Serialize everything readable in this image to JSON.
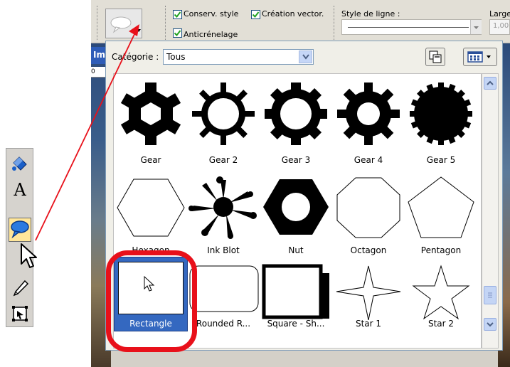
{
  "options_bar": {
    "preserve_style": "Conserv. style",
    "create_vector": "Création vector.",
    "antialias": "Anticrénelage",
    "line_style_label": "Style de ligne :",
    "width_label": "Large",
    "width_value": "1,00"
  },
  "workspace_tab": {
    "label": "Im",
    "ruler_value": "0"
  },
  "panel": {
    "category_label": "Catégorie :",
    "category_value": "Tous"
  },
  "shapes": [
    {
      "label": "Gear"
    },
    {
      "label": "Gear 2"
    },
    {
      "label": "Gear 3"
    },
    {
      "label": "Gear 4"
    },
    {
      "label": "Gear 5"
    },
    {
      "label": "Hexagon"
    },
    {
      "label": "Ink Blot"
    },
    {
      "label": "Nut"
    },
    {
      "label": "Octagon"
    },
    {
      "label": "Pentagon"
    },
    {
      "label": "Rectangle"
    },
    {
      "label": "Rounded R..."
    },
    {
      "label": "Square - Sh..."
    },
    {
      "label": "Star 1"
    },
    {
      "label": "Star 2"
    }
  ],
  "colors": {
    "selection": "#3468c0",
    "highlight_red": "#e8101a",
    "scrollbar_blue": "#c4d5f5",
    "tool_selected": "#ffe69a"
  },
  "icons": {
    "left_tools": [
      "fill-bucket-icon",
      "text-tool-icon",
      "preset-shape-tool-icon",
      "pen-tool-icon",
      "object-selector-icon"
    ],
    "panel": [
      "copy-icon",
      "view-menu-icon"
    ]
  }
}
